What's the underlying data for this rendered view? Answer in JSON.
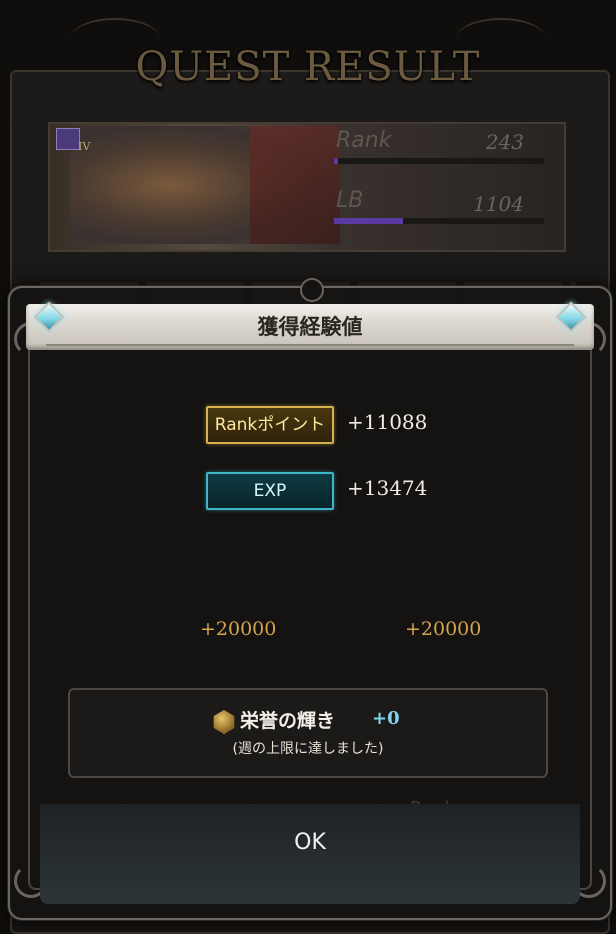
{
  "background": {
    "title": "QUEST RESULT",
    "class_rank": "IV",
    "stats": [
      {
        "label": "Rank",
        "value": "243",
        "fill": 0.02
      },
      {
        "label": "LB",
        "value": "1104",
        "fill": 0.33
      }
    ]
  },
  "modal": {
    "title": "獲得経験値",
    "rows": [
      {
        "tag": "Rankポイント",
        "value": "+11088"
      },
      {
        "tag": "EXP",
        "value": "+13474"
      }
    ],
    "bonuses": [
      "+20000",
      "+20000"
    ],
    "honor": {
      "label": "栄誉の輝き",
      "value": "+0",
      "note": "(週の上限に達しました)"
    },
    "ok_label": "OK"
  },
  "colors": {
    "rank_tag_border": "#d6b04c",
    "exp_tag_border": "#3fb6c8",
    "bonus_text": "#d4a450",
    "honor_value": "#7fd4ea"
  }
}
